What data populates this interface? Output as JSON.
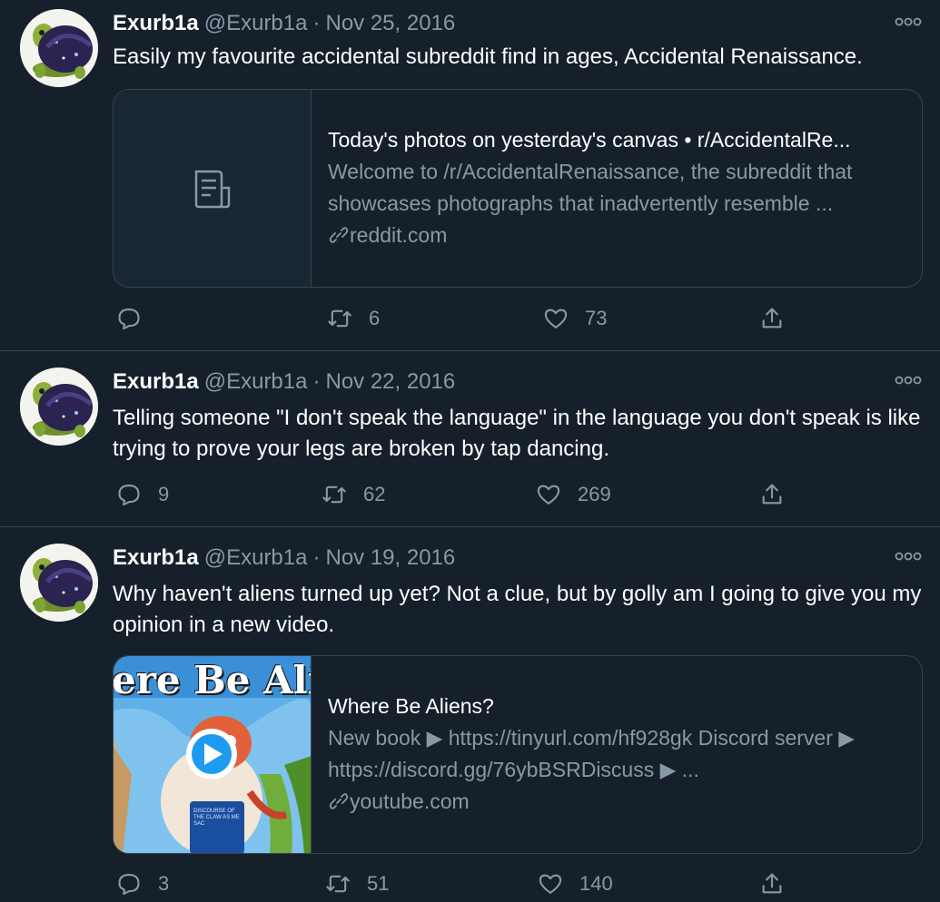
{
  "colors": {
    "background": "#15202b",
    "border": "#38444d",
    "secondary_text": "#8899a6",
    "primary_text": "#ffffff",
    "play_blue": "#1d9bf0"
  },
  "tweets": [
    {
      "name": "Exurb1a",
      "handle": "@Exurb1a",
      "separator": "·",
      "date": "Nov 25, 2016",
      "text": "Easily my favourite accidental subreddit find in ages, Accidental Renaissance.",
      "card": {
        "thumbnail_icon": "document-icon",
        "title": "Today's photos on yesterday's canvas • r/AccidentalRe...",
        "description": "Welcome to /r/AccidentalRenaissance, the subreddit that showcases photographs that inadvertently resemble ...",
        "domain": "reddit.com"
      },
      "replies": "",
      "retweets": "6",
      "likes": "73"
    },
    {
      "name": "Exurb1a",
      "handle": "@Exurb1a",
      "separator": "·",
      "date": "Nov 22, 2016",
      "text": "Telling someone \"I don't speak the language\" in the language you don't speak is like trying to prove your legs are broken by tap dancing.",
      "replies": "9",
      "retweets": "62",
      "likes": "269"
    },
    {
      "name": "Exurb1a",
      "handle": "@Exurb1a",
      "separator": "·",
      "date": "Nov 19, 2016",
      "text": "Why haven't aliens turned up yet? Not a clue, but by golly am I going to give you my opinion in a new video.",
      "card": {
        "thumbnail_caption": "ere Be Alie",
        "book_text": "DISCOURSE OF THE CLAW AS ME SAC",
        "title": "Where Be Aliens?",
        "description": "New book ▶ https://tinyurl.com/hf928gk Discord server ▶ https://discord.gg/76ybBSRDiscuss ▶ ...",
        "domain": "youtube.com"
      },
      "replies": "3",
      "retweets": "51",
      "likes": "140"
    }
  ]
}
